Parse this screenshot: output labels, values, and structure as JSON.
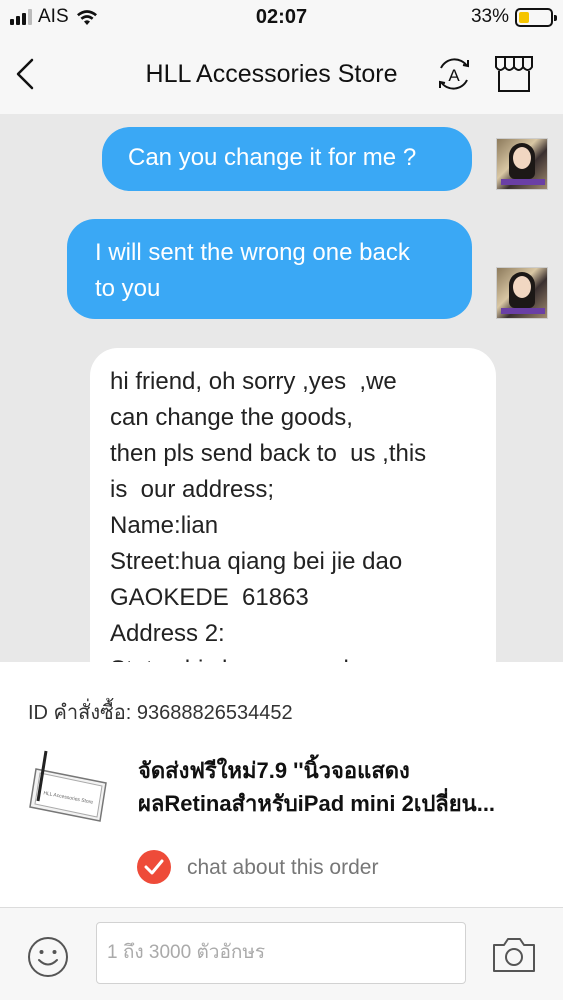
{
  "status_bar": {
    "carrier": "AIS",
    "time": "02:07",
    "battery_percent": "33%",
    "battery_level": 0.33
  },
  "header": {
    "title": "HLL Accessories Store",
    "translate_label": "A"
  },
  "messages": [
    {
      "direction": "out",
      "text": "Can you change it for me ?"
    },
    {
      "direction": "out",
      "lines": [
        "I will sent the wrong one back",
        "to you"
      ]
    },
    {
      "direction": "in",
      "lines": [
        "hi friend, oh sorry ,yes  ,we",
        "can change the goods,",
        "then pls send back to  us ,this",
        "is  our address;",
        "Name:lian",
        "Street:hua qiang bei jie dao",
        "GAOKEDE  61863",
        "Address 2:",
        "State:shi zhen guangdong"
      ]
    }
  ],
  "order": {
    "id_label": "ID คำสั่งซื้อ:",
    "id_value": "93688826534452",
    "product_title_line1": "จัดส่งฟรีใหม่7.9 ''นิ้วจอแสดง",
    "product_title_line2": "ผลRetinaสำหรับiPad mini 2เปลี่ยน...",
    "thumb_text": "HLL Accessories Store",
    "chat_about_label": "chat about this order"
  },
  "input": {
    "placeholder": "1 ถึง 3000 ตัวอักษร"
  },
  "colors": {
    "accent_blue": "#3aa8f5",
    "check_red": "#ee4b39",
    "chat_bg": "#e8e8e8"
  },
  "icons": {
    "back": "chevron-left-icon",
    "translate": "translate-icon",
    "store": "store-icon",
    "emoji": "smiley-icon",
    "camera": "camera-icon",
    "check": "checkmark-icon"
  }
}
